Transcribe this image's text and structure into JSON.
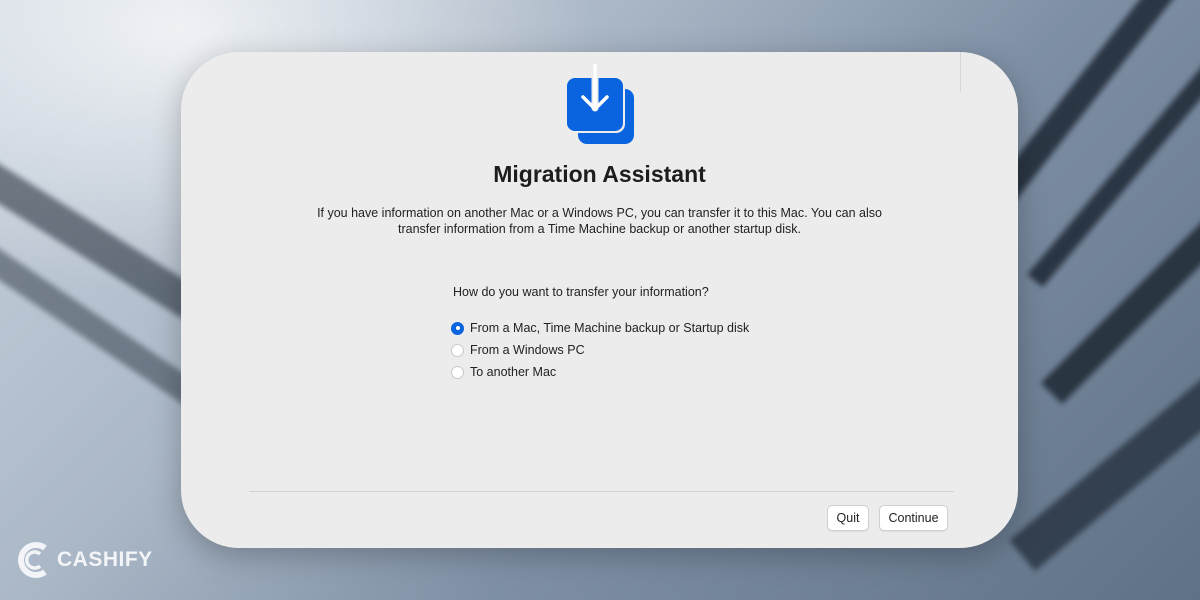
{
  "app": {
    "icon": "migration-assistant-icon",
    "title": "Migration Assistant",
    "description": "If you have information on another Mac or a Windows PC, you can transfer it to this Mac. You can also transfer information from a Time Machine backup or another startup disk."
  },
  "transfer": {
    "question": "How do you want to transfer your information?",
    "options": [
      {
        "label": "From a Mac, Time Machine backup or Startup disk",
        "selected": true
      },
      {
        "label": "From a Windows PC",
        "selected": false
      },
      {
        "label": "To another Mac",
        "selected": false
      }
    ]
  },
  "buttons": {
    "quit": "Quit",
    "continue": "Continue"
  },
  "watermark": {
    "text": "CASHIFY"
  },
  "colors": {
    "accent": "#0a64e0",
    "window_bg": "#ececec"
  }
}
